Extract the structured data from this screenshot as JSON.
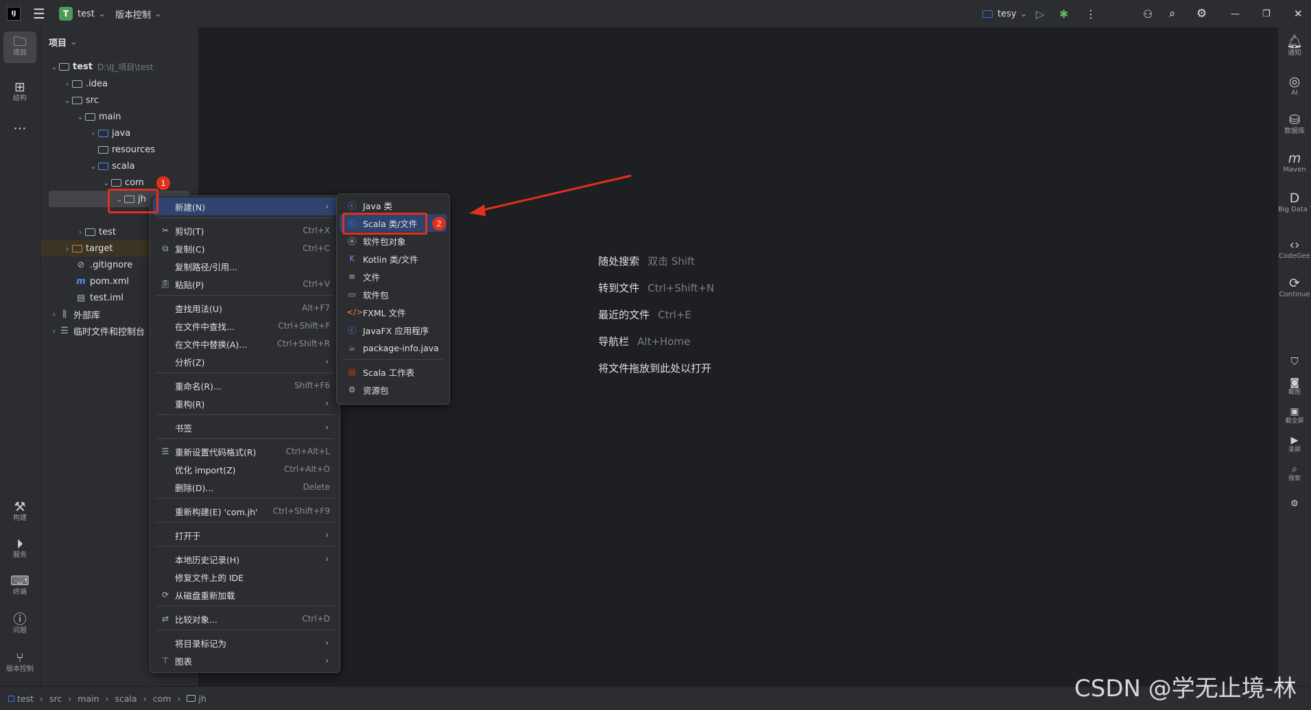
{
  "titlebar": {
    "project_initial": "T",
    "project_name": "test",
    "vcs_label": "版本控制",
    "run_config": "tesy",
    "chevron": "⌄"
  },
  "left_tools": [
    {
      "label": "项目",
      "icon": "folder-icon"
    },
    {
      "label": "结构",
      "icon": "structure-icon"
    },
    {
      "label": "构建",
      "icon": "hammer-icon"
    },
    {
      "label": "服务",
      "icon": "services-icon"
    },
    {
      "label": "终端",
      "icon": "terminal-icon"
    },
    {
      "label": "问题",
      "icon": "problems-icon"
    },
    {
      "label": "版本控制",
      "icon": "git-branch-icon"
    }
  ],
  "right_tools": [
    {
      "label": "通知",
      "icon": "bell-icon"
    },
    {
      "label": "AI",
      "icon": "ai-icon"
    },
    {
      "label": "数据库",
      "icon": "database-icon"
    },
    {
      "label": "Maven",
      "icon": "maven-icon"
    },
    {
      "label": "Big Data Too",
      "icon": "bigdata-icon"
    },
    {
      "label": "CodeGee",
      "icon": "codegeex-icon"
    },
    {
      "label": "Continue",
      "icon": "continue-icon"
    },
    {
      "label": "截图",
      "icon": "camera-icon"
    },
    {
      "label": "截全屏",
      "icon": "screen-icon"
    },
    {
      "label": "录屏",
      "icon": "record-icon"
    },
    {
      "label": "搜索",
      "icon": "search-icon"
    }
  ],
  "project_panel": {
    "title": "项目",
    "tree": [
      {
        "label": "test",
        "path": "D:\\IJ_项目\\test"
      },
      {
        "label": ".idea"
      },
      {
        "label": "src"
      },
      {
        "label": "main"
      },
      {
        "label": "java"
      },
      {
        "label": "resources"
      },
      {
        "label": "scala"
      },
      {
        "label": "com"
      },
      {
        "label": "jh"
      },
      {
        "label": "test"
      },
      {
        "label": "target"
      },
      {
        "label": ".gitignore"
      },
      {
        "label": "pom.xml"
      },
      {
        "label": "test.iml"
      },
      {
        "label": "外部库"
      },
      {
        "label": "临时文件和控制台"
      }
    ]
  },
  "context_menu": {
    "items": [
      {
        "label": "新建(N)",
        "shortcut": ""
      },
      {
        "label": "剪切(T)",
        "shortcut": "Ctrl+X"
      },
      {
        "label": "复制(C)",
        "shortcut": "Ctrl+C"
      },
      {
        "label": "复制路径/引用...",
        "shortcut": ""
      },
      {
        "label": "粘贴(P)",
        "shortcut": "Ctrl+V"
      },
      {
        "label": "查找用法(U)",
        "shortcut": "Alt+F7"
      },
      {
        "label": "在文件中查找...",
        "shortcut": "Ctrl+Shift+F"
      },
      {
        "label": "在文件中替换(A)...",
        "shortcut": "Ctrl+Shift+R"
      },
      {
        "label": "分析(Z)",
        "shortcut": ""
      },
      {
        "label": "重命名(R)...",
        "shortcut": "Shift+F6"
      },
      {
        "label": "重构(R)",
        "shortcut": ""
      },
      {
        "label": "书签",
        "shortcut": ""
      },
      {
        "label": "重新设置代码格式(R)",
        "shortcut": "Ctrl+Alt+L"
      },
      {
        "label": "优化 import(Z)",
        "shortcut": "Ctrl+Alt+O"
      },
      {
        "label": "删除(D)...",
        "shortcut": "Delete"
      },
      {
        "label": "重新构建(E) 'com.jh'",
        "shortcut": "Ctrl+Shift+F9"
      },
      {
        "label": "打开于",
        "shortcut": ""
      },
      {
        "label": "本地历史记录(H)",
        "shortcut": ""
      },
      {
        "label": "修复文件上的 IDE",
        "shortcut": ""
      },
      {
        "label": "从磁盘重新加载",
        "shortcut": ""
      },
      {
        "label": "比较对象...",
        "shortcut": "Ctrl+D"
      },
      {
        "label": "将目录标记为",
        "shortcut": ""
      },
      {
        "label": "图表",
        "shortcut": ""
      }
    ]
  },
  "submenu": {
    "items": [
      {
        "label": "Java 类",
        "icon": "java-class-icon"
      },
      {
        "label": "Scala 类/文件",
        "icon": "scala-class-icon"
      },
      {
        "label": "软件包对象",
        "icon": "package-object-icon"
      },
      {
        "label": "Kotlin 类/文件",
        "icon": "kotlin-icon"
      },
      {
        "label": "文件",
        "icon": "file-icon"
      },
      {
        "label": "软件包",
        "icon": "package-icon"
      },
      {
        "label": "FXML 文件",
        "icon": "fxml-icon"
      },
      {
        "label": "JavaFX 应用程序",
        "icon": "javafx-icon"
      },
      {
        "label": "package-info.java",
        "icon": "package-info-icon"
      },
      {
        "label": "Scala 工作表",
        "icon": "scala-worksheet-icon"
      },
      {
        "label": "资源包",
        "icon": "resource-bundle-icon"
      }
    ]
  },
  "annotations": {
    "badge1": "1",
    "badge2": "2"
  },
  "editor_hints": [
    {
      "action": "随处搜索",
      "key": "双击 Shift"
    },
    {
      "action": "转到文件",
      "key": "Ctrl+Shift+N"
    },
    {
      "action": "最近的文件",
      "key": "Ctrl+E"
    },
    {
      "action": "导航栏",
      "key": "Alt+Home"
    },
    {
      "action": "将文件拖放到此处以打开",
      "key": ""
    }
  ],
  "breadcrumbs": [
    "test",
    "src",
    "main",
    "scala",
    "com",
    "jh"
  ],
  "watermark": "CSDN @学无止境-林",
  "colors": {
    "accent": "#3574f0",
    "selection": "#2e436e",
    "annotation_red": "#e2301e",
    "run_green": "#5fb865"
  }
}
